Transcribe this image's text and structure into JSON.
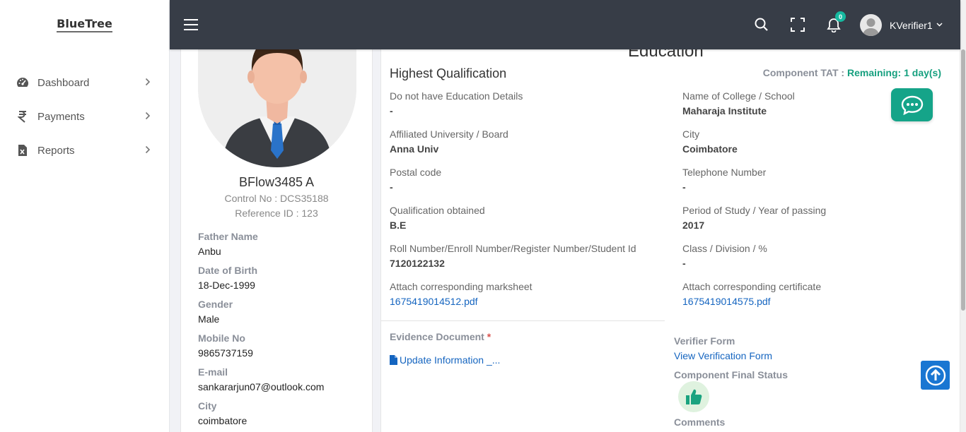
{
  "brand": {
    "name": "BlueTree"
  },
  "sidebar": {
    "items": [
      {
        "label": "Dashboard",
        "icon": "gauge-icon"
      },
      {
        "label": "Payments",
        "icon": "rupee-icon"
      },
      {
        "label": "Reports",
        "icon": "excel-file-icon"
      }
    ]
  },
  "topbar": {
    "notification_count": "0",
    "username": "KVerifier1"
  },
  "profile": {
    "name": "BFlow3485 A",
    "control_no": "Control No : DCS35188",
    "reference_id": "Reference ID : 123",
    "fields": [
      {
        "label": "Father Name",
        "value": "Anbu"
      },
      {
        "label": "Date of Birth",
        "value": "18-Dec-1999"
      },
      {
        "label": "Gender",
        "value": "Male"
      },
      {
        "label": "Mobile No",
        "value": "9865737159"
      },
      {
        "label": "E-mail",
        "value": "sankararjun07@outlook.com"
      },
      {
        "label": "City",
        "value": "coimbatore"
      }
    ]
  },
  "education": {
    "title": "Education",
    "section_title": "Highest Qualification",
    "tat_label": "Component TAT : ",
    "tat_value": "Remaining: 1 day(s)",
    "left_fields": [
      {
        "label": "Do not have Education Details",
        "value": "-"
      },
      {
        "label": "Affiliated University / Board",
        "value": "Anna Univ"
      },
      {
        "label": "Postal code",
        "value": "-"
      },
      {
        "label": "Qualification obtained",
        "value": "B.E"
      },
      {
        "label": "Roll Number/Enroll Number/Register Number/Student Id",
        "value": "7120122132"
      },
      {
        "label": "Attach corresponding marksheet",
        "value": "1675419014512.pdf"
      }
    ],
    "right_fields": [
      {
        "label": "Name of College / School",
        "value": "Maharaja Institute"
      },
      {
        "label": "City",
        "value": "Coimbatore"
      },
      {
        "label": "Telephone Number",
        "value": "-"
      },
      {
        "label": "Period of Study / Year of passing",
        "value": "2017"
      },
      {
        "label": "Class / Division / %",
        "value": "-"
      },
      {
        "label": "Attach corresponding certificate",
        "value": "1675419014575.pdf"
      }
    ],
    "evidence_label": "Evidence Document",
    "evidence_required": "*",
    "evidence_link": "Update Information _...",
    "verifier_form_label": "Verifier Form",
    "verifier_form_link": "View Verification Form",
    "final_status_label": "Component Final Status",
    "comments_label": "Comments"
  },
  "colors": {
    "topbar": "#373d47",
    "accent_green": "#16a07f",
    "link_blue": "#1565c0",
    "scroll_top_blue": "#1976d2"
  }
}
